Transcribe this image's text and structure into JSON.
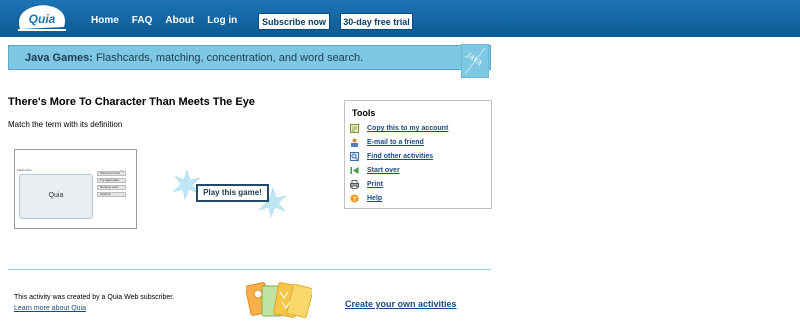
{
  "header": {
    "logo_text": "Quia",
    "nav": [
      "Home",
      "FAQ",
      "About",
      "Log in"
    ],
    "subscribe_label": "Subscribe now",
    "trial_label": "30-day free trial"
  },
  "banner": {
    "bold": "Java Games:",
    "text": " Flashcards, matching, concentration, and word search.",
    "icon_text": "JAVA"
  },
  "activity": {
    "title": "There's More To Character Than Meets The Eye",
    "subtitle": "Match the term with its definition",
    "play_label": "Play this game!",
    "preview": {
      "header": "Flashcards",
      "card_text": "Quia",
      "count": "20",
      "options": [
        "Show term first",
        "Try again later",
        "Remove card",
        "Options"
      ]
    }
  },
  "tools": {
    "heading": "Tools",
    "items": [
      {
        "label": "Copy this to my account",
        "icon": "copy-icon"
      },
      {
        "label": "E-mail to a friend",
        "icon": "email-icon"
      },
      {
        "label": "Find other activities",
        "icon": "search-icon"
      },
      {
        "label": "Start over",
        "icon": "restart-icon"
      },
      {
        "label": "Print",
        "icon": "printer-icon"
      },
      {
        "label": "Help",
        "icon": "help-icon"
      }
    ]
  },
  "footer": {
    "credit": "This activity was created by a Quia Web subscriber.",
    "learn_more": "Learn more about Quia",
    "create": "Create your own activities"
  },
  "colors": {
    "header_blue": "#0c5a94",
    "banner_blue": "#7ec8e3",
    "link_blue": "#1a4a84",
    "divider": "#8fd2cf"
  }
}
